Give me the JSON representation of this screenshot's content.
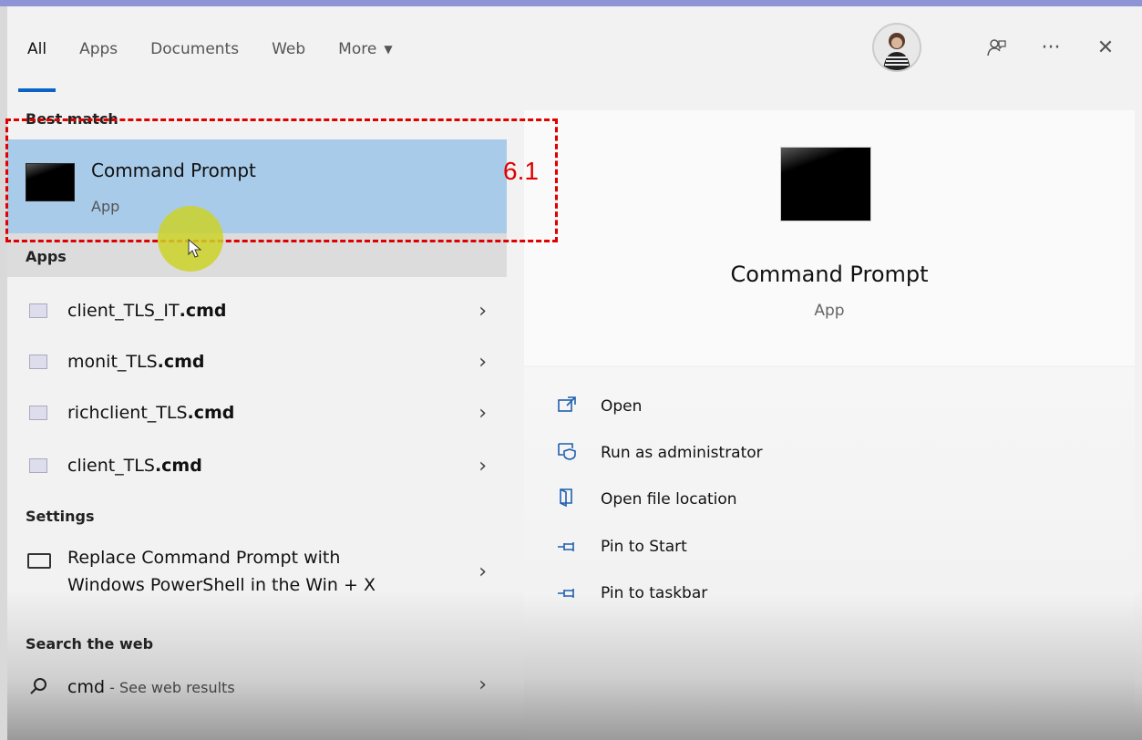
{
  "tabs": [
    {
      "label": "All",
      "active": true
    },
    {
      "label": "Apps",
      "active": false
    },
    {
      "label": "Documents",
      "active": false
    },
    {
      "label": "Web",
      "active": false
    },
    {
      "label": "More",
      "active": false
    }
  ],
  "left": {
    "best_match_header": "Best match",
    "best_match": {
      "title": "Command Prompt",
      "subtitle": "App"
    },
    "apps_header": "Apps",
    "apps": [
      {
        "name": "client_TLS_IT",
        "ext": ".cmd"
      },
      {
        "name": "monit_TLS",
        "ext": ".cmd"
      },
      {
        "name": "richclient_TLS",
        "ext": ".cmd"
      },
      {
        "name": "client_TLS",
        "ext": ".cmd"
      }
    ],
    "settings_header": "Settings",
    "settings_item": {
      "line1": "Replace Command Prompt with",
      "line2": "Windows PowerShell in the Win + X"
    },
    "web_header": "Search the web",
    "web_item": {
      "query": "cmd",
      "suffix": " - See web results"
    }
  },
  "right": {
    "title": "Command Prompt",
    "subtitle": "App",
    "actions": [
      {
        "label": "Open",
        "icon": "open-icon"
      },
      {
        "label": "Run as administrator",
        "icon": "shield-window-icon"
      },
      {
        "label": "Open file location",
        "icon": "folder-icon"
      },
      {
        "label": "Pin to Start",
        "icon": "pin-icon"
      },
      {
        "label": "Pin to taskbar",
        "icon": "pin-icon"
      }
    ]
  },
  "annotation": {
    "label": "6.1",
    "color": "#e00000"
  },
  "colors": {
    "accent": "#0a64c8",
    "selection": "#a8cbea",
    "icon_blue": "#1f5fae"
  }
}
